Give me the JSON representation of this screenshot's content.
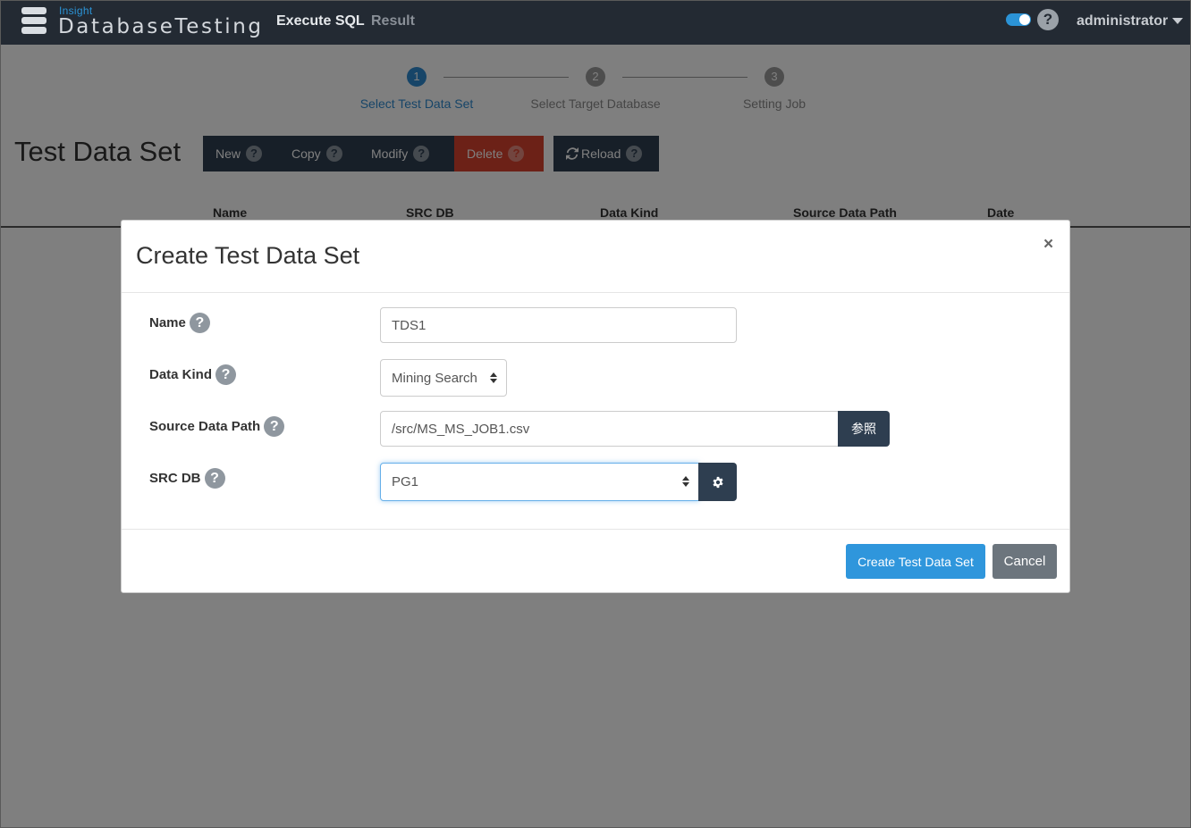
{
  "navbar": {
    "logo_sub": "Insight",
    "logo_main": "DatabaseTesting",
    "execute_sql": "Execute SQL",
    "result": "Result",
    "help_glyph": "?",
    "user": "administrator"
  },
  "wizard": {
    "steps": [
      {
        "number": "1",
        "label": "Select Test Data Set",
        "active": true
      },
      {
        "number": "2",
        "label": "Select Target Database",
        "active": false
      },
      {
        "number": "3",
        "label": "Setting Job",
        "active": false
      }
    ]
  },
  "page": {
    "title": "Test Data Set",
    "buttons": {
      "new": "New",
      "copy": "Copy",
      "modify": "Modify",
      "delete": "Delete",
      "reload": "Reload"
    },
    "help_glyph": "?",
    "table_headers": [
      "Name",
      "SRC DB",
      "Data Kind",
      "Source Data Path",
      "Date"
    ]
  },
  "modal": {
    "title": "Create Test Data Set",
    "close_glyph": "×",
    "help_glyph": "?",
    "fields": {
      "name": {
        "label": "Name",
        "value": "TDS1"
      },
      "data_kind": {
        "label": "Data Kind",
        "value": "Mining Search"
      },
      "source_data_path": {
        "label": "Source Data Path",
        "value": "/src/MS_MS_JOB1.csv",
        "browse_label": "参照"
      },
      "src_db": {
        "label": "SRC DB",
        "value": "PG1"
      }
    },
    "create_button": "Create Test Data Set",
    "cancel_button": "Cancel"
  },
  "icons": {
    "help": "question-circle-icon",
    "gear": "gear-icon",
    "reload": "refresh-icon",
    "close": "close-icon"
  },
  "colors": {
    "navbar": "#232a33",
    "primary": "#2f96dc",
    "dark_button": "#2e3e50",
    "danger": "#d9422e",
    "secondary": "#6c757d"
  }
}
